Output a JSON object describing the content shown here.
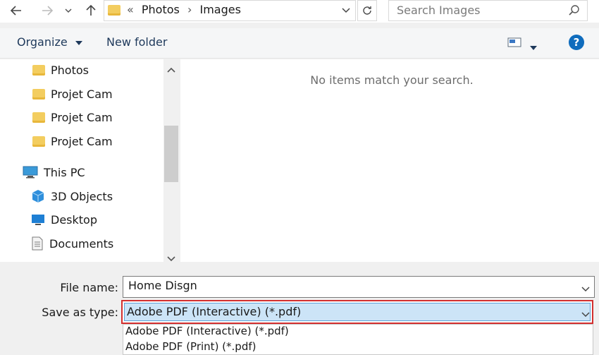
{
  "address": {
    "overflow": "«",
    "crumbs": [
      "Photos",
      "Images"
    ]
  },
  "search": {
    "placeholder": "Search Images"
  },
  "toolbar": {
    "organize": "Organize",
    "new_folder": "New folder"
  },
  "nav": {
    "items": [
      {
        "label": "Photos",
        "icon": "folder-icon"
      },
      {
        "label": "Projet Cam",
        "icon": "folder-icon"
      },
      {
        "label": "Projet Cam",
        "icon": "folder-icon"
      },
      {
        "label": "Projet Cam",
        "icon": "folder-icon"
      },
      {
        "label": "This PC",
        "icon": "computer-icon"
      },
      {
        "label": "3D Objects",
        "icon": "cube-icon"
      },
      {
        "label": "Desktop",
        "icon": "desktop-icon"
      },
      {
        "label": "Documents",
        "icon": "document-icon"
      }
    ]
  },
  "content": {
    "empty_message": "No items match your search."
  },
  "form": {
    "file_name_label": "File name:",
    "file_name_value": "Home Disgn",
    "save_type_label": "Save as type:",
    "save_type_value": "Adobe PDF (Interactive) (*.pdf)",
    "type_options": [
      "Adobe PDF (Interactive) (*.pdf)",
      "Adobe PDF (Print) (*.pdf)"
    ]
  },
  "colors": {
    "accent": "#0078d7",
    "highlight": "#cce4f7",
    "outline": "#d32f2f",
    "folder": "#f3cd5f"
  }
}
